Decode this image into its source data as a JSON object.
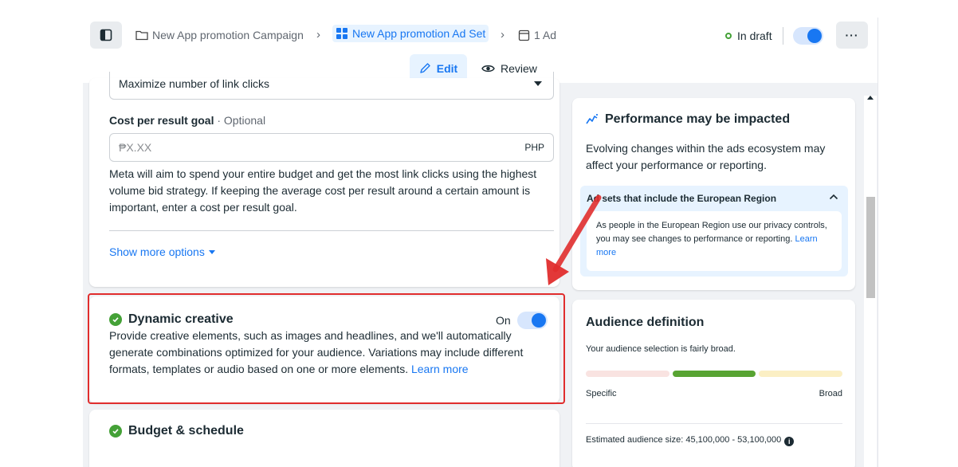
{
  "topbar": {
    "breadcrumbs": [
      {
        "label": "New App promotion Campaign",
        "icon": "folder-icon"
      },
      {
        "label": "New App promotion Ad Set",
        "icon": "grid-icon"
      },
      {
        "label": "1 Ad",
        "icon": "ad-icon"
      }
    ],
    "status": "In draft",
    "status_color": "#44a137"
  },
  "modes": {
    "edit": "Edit",
    "review": "Review"
  },
  "optimization": {
    "selected": "Maximize number of link clicks"
  },
  "cost_goal": {
    "label": "Cost per result goal",
    "optional": " · Optional",
    "placeholder": "₱X.XX",
    "currency": "PHP",
    "help": "Meta will aim to spend your entire budget and get the most link clicks using the highest volume bid strategy. If keeping the average cost per result around a certain amount is important, enter a cost per result goal."
  },
  "show_more": "Show more options",
  "dynamic_creative": {
    "title": "Dynamic creative",
    "toggle_label": "On",
    "description": "Provide creative elements, such as images and headlines, and we'll automatically generate combinations optimized for your audience. Variations may include different formats, templates or audio based on one or more elements. ",
    "learn_more": "Learn more"
  },
  "budget": {
    "title": "Budget & schedule"
  },
  "performance": {
    "title": "Performance may be impacted",
    "text": "Evolving changes within the ads ecosystem may affect your performance or reporting.",
    "notice_title": "Ad sets that include the European Region",
    "notice_text": "As people in the European Region use our privacy controls, you may see changes to performance or reporting. ",
    "notice_link": "Learn more"
  },
  "audience": {
    "title": "Audience definition",
    "text": "Your audience selection is fairly broad.",
    "specific": "Specific",
    "broad": "Broad",
    "estimated": "Estimated audience size: 45,100,000 - 53,100,000",
    "meter_colors": [
      "#f9e3e1",
      "#58a433",
      "#fbefc4"
    ]
  },
  "colors": {
    "accent": "#1877f2",
    "highlight": "#e02d2d"
  }
}
